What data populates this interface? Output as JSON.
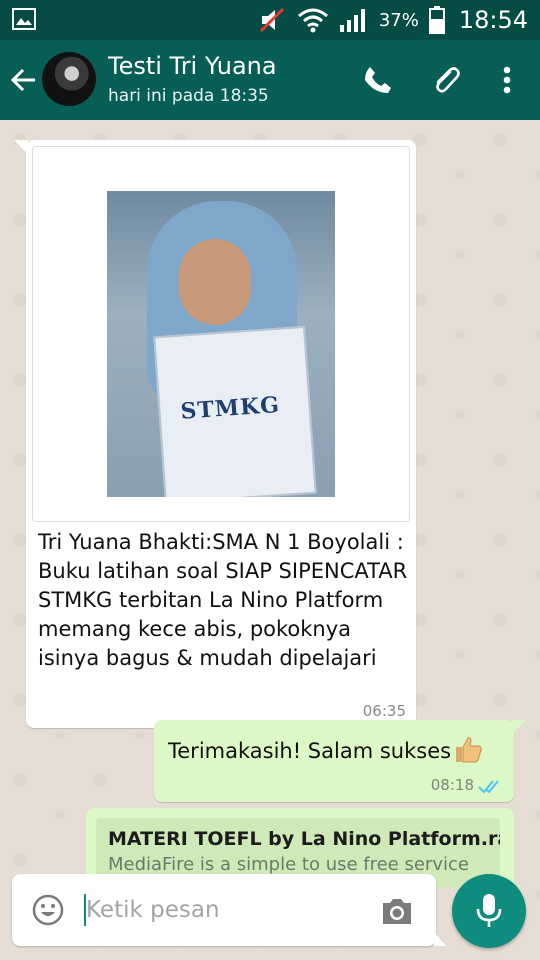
{
  "status_bar": {
    "battery_percent": "37%",
    "time": "18:54"
  },
  "header": {
    "contact_name": "Testi Tri Yuana",
    "last_seen": "hari ini pada 18:35"
  },
  "messages": [
    {
      "direction": "incoming",
      "image_text": "STMKG",
      "text": "Tri Yuana Bhakti:SMA N 1 Boyolali : Buku latihan soal SIAP SIPENCATAR STMKG terbitan La Nino Platform memang kece abis, pokoknya isinya bagus & mudah dipelajari",
      "time": "06:35"
    },
    {
      "direction": "outgoing",
      "text": "Terimakasih! Salam sukses",
      "time": "08:18"
    },
    {
      "direction": "outgoing",
      "link_title": "MATERI TOEFL by La Nino Platform.rar",
      "link_description": "MediaFire is a simple to use free service"
    }
  ],
  "composer": {
    "placeholder": "Ketik pesan"
  },
  "colors": {
    "header": "#075e54",
    "status_bar": "#054d44",
    "outgoing_bubble": "#dcf8c6",
    "mic_button": "#0e8c7e",
    "read_ticks": "#4fc3f7"
  },
  "icons": [
    "image-icon",
    "mute-icon",
    "wifi-icon",
    "signal-icon",
    "battery-icon",
    "back-arrow-icon",
    "phone-icon",
    "paperclip-icon",
    "more-vert-icon",
    "thumbs-up-icon",
    "double-check-icon",
    "emoji-icon",
    "camera-icon",
    "mic-icon"
  ]
}
